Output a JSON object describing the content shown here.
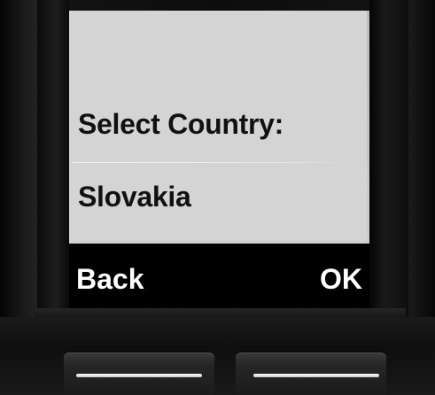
{
  "screen": {
    "title": "Select Country:",
    "selected_value": "Slovakia"
  },
  "softkeys": {
    "left_label": "Back",
    "right_label": "OK"
  },
  "colors": {
    "screen_background": "#d4d4d4",
    "softkey_bar": "#000000",
    "text_dark": "#111111",
    "text_light": "#ffffff",
    "device_body": "#0d0d0d"
  }
}
